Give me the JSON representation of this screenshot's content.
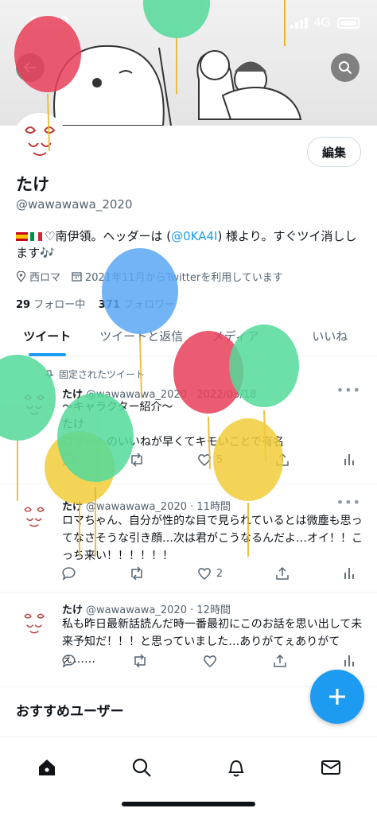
{
  "status_bar": {
    "time": "10:09",
    "network": "4G"
  },
  "profile": {
    "edit_label": "編集",
    "name": "たけ",
    "handle": "@wawawawa_2020",
    "bio_flags": [
      "spain-flag",
      "italy-flag"
    ],
    "bio_before": "♡南伊領。ヘッダーは (",
    "bio_mention": "@0KA4I",
    "bio_after": ") 様より。すぐツイ消しします🎶",
    "location": "西ロマ",
    "joined": "2021年11月からTwitterを利用しています",
    "following_count": "29",
    "following_label": "フォロー中",
    "followers_count": "371",
    "followers_label": "フォロワー"
  },
  "tabs": [
    {
      "label": "ツイート",
      "active": true
    },
    {
      "label": "ツイートと返信",
      "active": false
    },
    {
      "label": "メディア",
      "active": false
    },
    {
      "label": "いいね",
      "active": false
    }
  ],
  "tweets": [
    {
      "pinned_label": "固定されたツイート",
      "name": "たけ",
      "handle": "@wawawawa_2020",
      "time": "2022/03/18",
      "lines": [
        "〜キャラクター紹介〜",
        "たけ",
        "ロマーへのいいねが早くてキモいことで有名"
      ],
      "likes": "5"
    },
    {
      "name": "たけ",
      "handle": "@wawawawa_2020",
      "time": "11時間",
      "text": "ロマちゃん、自分が性的な目で見られているとは微塵も思ってなさそうな引き顔…次は君がこうなるんだよ…オイ！！こっち来い！！！！！！",
      "likes": "2"
    },
    {
      "name": "たけ",
      "handle": "@wawawawa_2020",
      "time": "12時間",
      "text": "私も昨日最新話読んだ時一番最初にこのお話を思い出して未来予知だ！！！と思っていました…ありがてぇありがてぇ……",
      "likes": ""
    }
  ],
  "recommend_title": "おすすめユーザー",
  "colors": {
    "accent": "#1d9bf0",
    "text": "#0f1419",
    "muted": "#536471"
  },
  "balloon_colors": [
    "#e8405a",
    "#54d99a",
    "#5aa7f5",
    "#f2cd3a"
  ]
}
